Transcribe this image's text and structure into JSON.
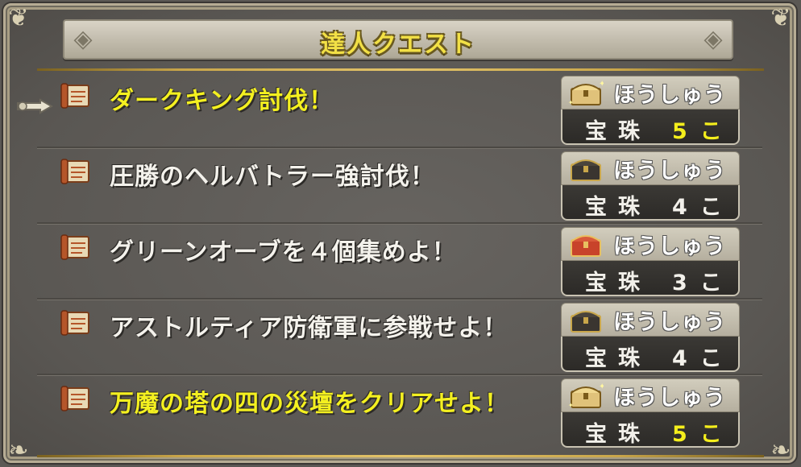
{
  "header": {
    "title": "達人クエスト"
  },
  "reward_label": "ほうしゅう",
  "quests": [
    {
      "name": "ダークキング討伐！",
      "highlight": true,
      "item": "宝珠",
      "count": "5",
      "unit": "こ",
      "chest": "gold"
    },
    {
      "name": "圧勝のヘルバトラー強討伐！",
      "highlight": false,
      "item": "宝珠",
      "count": "4",
      "unit": "こ",
      "chest": "dark"
    },
    {
      "name": "グリーンオーブを４個集めよ！",
      "highlight": false,
      "item": "宝珠",
      "count": "3",
      "unit": "こ",
      "chest": "red"
    },
    {
      "name": "アストルティア防衛軍に参戦せよ！",
      "highlight": false,
      "item": "宝珠",
      "count": "4",
      "unit": "こ",
      "chest": "dark"
    },
    {
      "name": "万魔の塔の四の災壇をクリアせよ！",
      "highlight": true,
      "item": "宝珠",
      "count": "5",
      "unit": "こ",
      "chest": "gold"
    }
  ],
  "colors": {
    "highlight_text": "#f4f020",
    "normal_text": "#f4f2ec",
    "title_text": "#f2e046"
  },
  "icons": {
    "quest": "scroll-icon",
    "cursor": "pointer-hand-icon",
    "chest_gold": "gold-chest-icon",
    "chest_dark": "dark-chest-icon",
    "chest_red": "red-chest-icon"
  }
}
